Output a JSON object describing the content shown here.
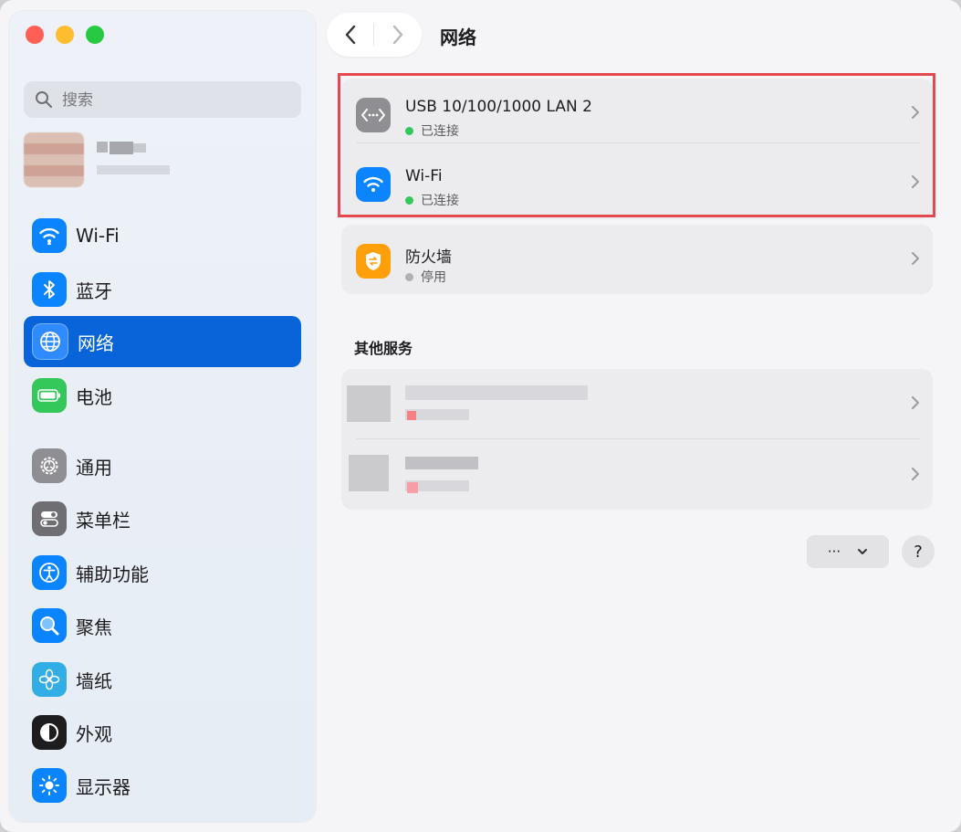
{
  "window": {
    "traffic_lights": [
      "close",
      "minimize",
      "zoom"
    ]
  },
  "sidebar": {
    "search": {
      "placeholder": "搜索",
      "value": ""
    },
    "items": [
      {
        "label": "Wi-Fi",
        "icon": "wifi-icon",
        "color": "#0a84ff"
      },
      {
        "label": "蓝牙",
        "icon": "bluetooth-icon",
        "color": "#0a84ff"
      },
      {
        "label": "网络",
        "icon": "globe-icon",
        "color": "#0a84ff",
        "active": true
      },
      {
        "label": "电池",
        "icon": "battery-icon",
        "color": "#34c759"
      },
      {
        "label": "通用",
        "icon": "gear-icon",
        "color": "#8e8e93"
      },
      {
        "label": "菜单栏",
        "icon": "menubar-icon",
        "color": "#6e6e73"
      },
      {
        "label": "辅助功能",
        "icon": "accessibility-icon",
        "color": "#0a84ff"
      },
      {
        "label": "聚焦",
        "icon": "magnifier-icon",
        "color": "#0a84ff"
      },
      {
        "label": "墙纸",
        "icon": "flower-icon",
        "color": "#32ade6"
      },
      {
        "label": "外观",
        "icon": "appearance-icon",
        "color": "#1d1d1f"
      },
      {
        "label": "显示器",
        "icon": "sun-icon",
        "color": "#0a84ff"
      }
    ]
  },
  "main": {
    "title": "网络",
    "services": [
      {
        "title": "USB 10/100/1000 LAN 2",
        "status": "已连接",
        "status_color": "#34c759",
        "icon": "ethernet-icon"
      },
      {
        "title": "Wi-Fi",
        "status": "已连接",
        "status_color": "#34c759",
        "icon": "wifi-icon"
      }
    ],
    "firewall": {
      "title": "防火墙",
      "status": "停用",
      "status_color": "#b0b0b5",
      "icon": "firewall-icon"
    },
    "other_heading": "其他服务",
    "more_label": "···",
    "help_label": "?"
  },
  "colors": {
    "accent": "#0a64d9",
    "highlight": "#e5484d"
  }
}
